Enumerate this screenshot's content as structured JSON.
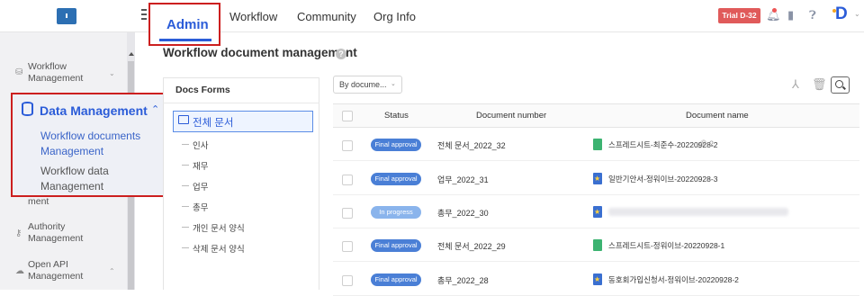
{
  "sidebar": {
    "items": [
      {
        "label": "Workflow Management"
      },
      {
        "label": "ment"
      },
      {
        "label": "Authority Management"
      },
      {
        "label": "Open API Management"
      }
    ],
    "data_management": {
      "title": "Data Management",
      "sub_items": [
        {
          "label": "Workflow documents Management"
        },
        {
          "label": "Workflow data Management"
        }
      ]
    }
  },
  "nav": {
    "tabs": [
      {
        "label": "Admin"
      },
      {
        "label": "Workflow"
      },
      {
        "label": "Community"
      },
      {
        "label": "Org Info"
      }
    ],
    "trial_badge": "Trial D-32"
  },
  "page": {
    "title": "Workflow document management",
    "help": "?"
  },
  "forms": {
    "title": "Docs Forms",
    "root": "전체 문서",
    "children": [
      "인사",
      "재무",
      "업무",
      "총무",
      "개인 문서 양식",
      "삭제 문서 양식"
    ]
  },
  "list": {
    "filter": "By docume...",
    "headers": {
      "status": "Status",
      "number": "Document number",
      "name": "Document name"
    },
    "rows": [
      {
        "status": "Final approval",
        "number": "전체 문서_2022_32",
        "name": "스프레드시트-최준수-20220928-2",
        "attachments": "2"
      },
      {
        "status": "Final approval",
        "number": "업무_2022_31",
        "name": "일반기안서-정워이브-20220928-3"
      },
      {
        "status": "In progress",
        "number": "총무_2022_30",
        "name": ""
      },
      {
        "status": "Final approval",
        "number": "전체 문서_2022_29",
        "name": "스프레드시트-정워이브-20220928-1"
      },
      {
        "status": "Final approval",
        "number": "총무_2022_28",
        "name": "동호회가입신청서-정워이브-20220928-2"
      }
    ]
  },
  "colors": {
    "accent": "#2b5cd8",
    "highlight_border": "#cc1f1f",
    "trial": "#e05a5a"
  }
}
